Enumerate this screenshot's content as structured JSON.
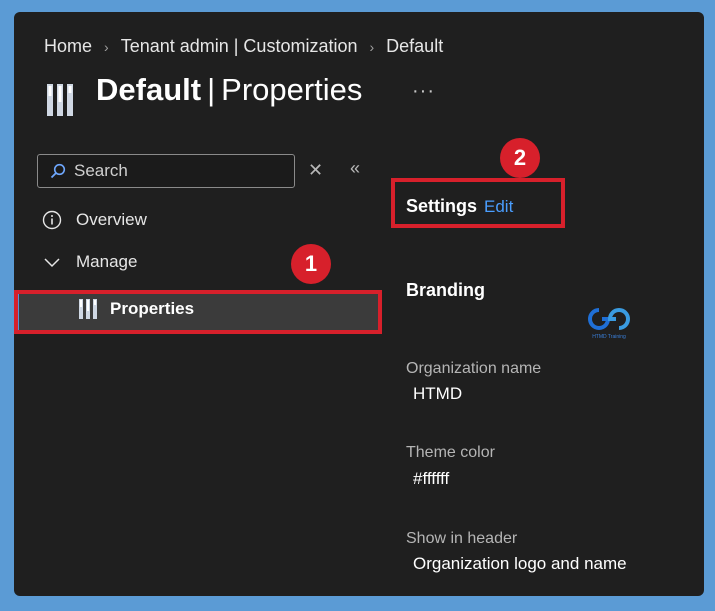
{
  "breadcrumb": {
    "home": "Home",
    "tenant": "Tenant admin | Customization",
    "current": "Default"
  },
  "page": {
    "title_bold": "Default",
    "title_pipe": "|",
    "title_light": "Properties",
    "more": "···"
  },
  "sidebar": {
    "search_placeholder": "Search",
    "clear": "✕",
    "collapse": "«",
    "overview": "Overview",
    "manage": "Manage",
    "properties": "Properties"
  },
  "callouts": {
    "one": "1",
    "two": "2"
  },
  "main": {
    "settings_label": "Settings",
    "edit_label": "Edit",
    "branding_title": "Branding",
    "fields": [
      {
        "label": "Organization name",
        "value": "HTMD"
      },
      {
        "label": "Theme color",
        "value": "#ffffff"
      },
      {
        "label": "Show in header",
        "value": "Organization logo and name"
      }
    ]
  },
  "watermark": {
    "text": "HTMD Training"
  },
  "colors": {
    "accent_red": "#d7202b",
    "link_blue": "#4a9eff",
    "background": "#1f1f1f",
    "outer": "#5b9bd5"
  }
}
